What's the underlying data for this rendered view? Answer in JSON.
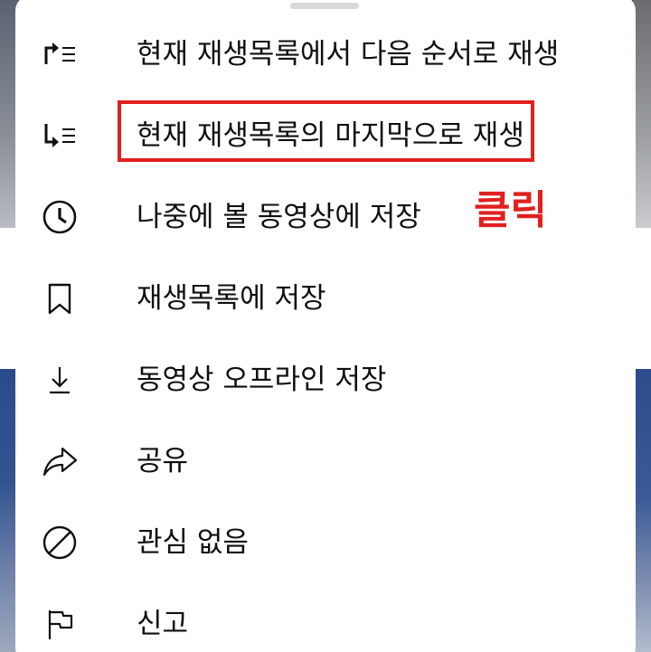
{
  "menu": {
    "items": [
      {
        "id": "play-next",
        "label": "현재 재생목록에서 다음 순서로 재생",
        "icon": "play-next-icon"
      },
      {
        "id": "play-last",
        "label": "현재 재생목록의 마지막으로 재생",
        "icon": "play-last-icon"
      },
      {
        "id": "watch-later",
        "label": "나중에 볼 동영상에 저장",
        "icon": "clock-icon"
      },
      {
        "id": "save-playlist",
        "label": "재생목록에 저장",
        "icon": "bookmark-icon"
      },
      {
        "id": "download",
        "label": "동영상 오프라인 저장",
        "icon": "download-icon"
      },
      {
        "id": "share",
        "label": "공유",
        "icon": "share-icon"
      },
      {
        "id": "not-interested",
        "label": "관심 없음",
        "icon": "block-icon"
      },
      {
        "id": "report",
        "label": "신고",
        "icon": "flag-icon"
      }
    ]
  },
  "annotation": {
    "text": "클릭",
    "color": "#e0211f"
  },
  "colors": {
    "text": "#0f0f0f",
    "sheet": "#ffffff",
    "accent": "#e0211f"
  }
}
